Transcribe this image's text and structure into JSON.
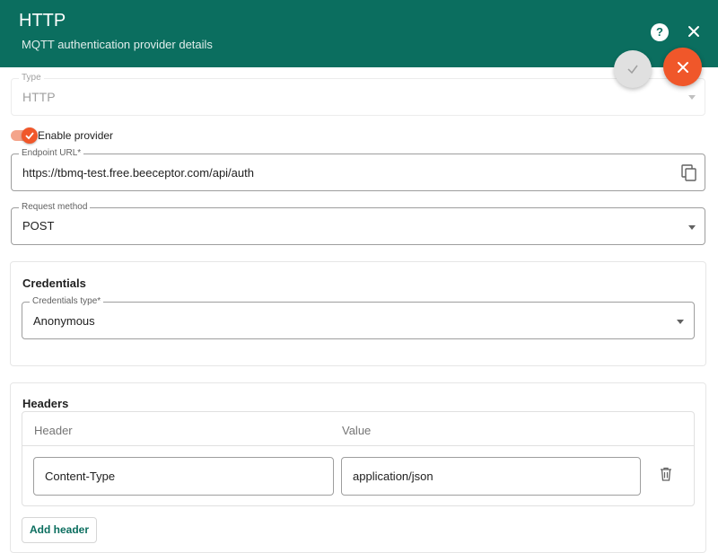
{
  "header": {
    "title": "HTTP",
    "subtitle": "MQTT authentication provider details",
    "help_glyph": "?"
  },
  "type_field": {
    "label": "Type",
    "value": "HTTP"
  },
  "enable_provider": {
    "label": "Enable provider",
    "checked": true
  },
  "endpoint": {
    "label": "Endpoint URL*",
    "value": "https://tbmq-test.free.beeceptor.com/api/auth"
  },
  "request_method": {
    "label": "Request method",
    "value": "POST"
  },
  "credentials": {
    "title": "Credentials",
    "type_label": "Credentials type*",
    "type_value": "Anonymous"
  },
  "headers": {
    "title": "Headers",
    "column_header": "Header",
    "column_value": "Value",
    "rows": [
      {
        "header": "Content-Type",
        "value": "application/json"
      }
    ],
    "add_label": "Add header"
  },
  "colors": {
    "header_bg": "#0b6e5f",
    "accent": "#f0572a",
    "primary_text": "#0b6e5f"
  },
  "icons": [
    "help-icon",
    "close-icon",
    "check-icon",
    "copy-icon",
    "chevron-down-icon",
    "trash-icon"
  ]
}
